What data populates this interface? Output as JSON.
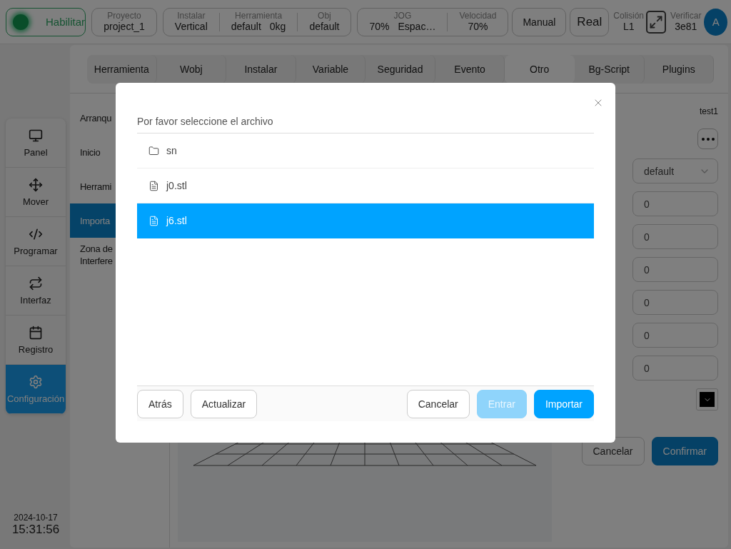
{
  "header": {
    "enable": {
      "label": "Habilitar",
      "on": true
    },
    "groups": [
      [
        {
          "label": "Proyecto",
          "values": [
            "project_1"
          ]
        }
      ],
      [
        {
          "label": "Instalar",
          "values": [
            "Vertical"
          ]
        },
        {
          "label": "Herramienta",
          "values": [
            "default",
            "0kg"
          ]
        },
        {
          "label": "Obj",
          "values": [
            "default"
          ]
        }
      ],
      [
        {
          "label": "JOG",
          "values": [
            "70%",
            "Espac…"
          ]
        },
        {
          "label": "Velocidad",
          "values": [
            "70%"
          ]
        }
      ]
    ],
    "mode_buttons": [
      "Manual",
      "Real"
    ],
    "collision": {
      "label": "Colisión",
      "value": "L1"
    },
    "verify": {
      "label": "Verificar",
      "value": "3e81"
    },
    "avatar": "A"
  },
  "nav": [
    {
      "label": "Panel",
      "selected": false
    },
    {
      "label": "Mover",
      "selected": false
    },
    {
      "label": "Programar",
      "selected": false
    },
    {
      "label": "Interfaz",
      "selected": false
    },
    {
      "label": "Registro",
      "selected": false
    },
    {
      "label": "Configuración",
      "selected": true
    }
  ],
  "datetime": {
    "date": "2024-10-17",
    "time": "15:31:56"
  },
  "tabs": [
    {
      "label": "Herramienta",
      "selected": false
    },
    {
      "label": "Wobj",
      "selected": false
    },
    {
      "label": "Instalar",
      "selected": false
    },
    {
      "label": "Variable",
      "selected": false
    },
    {
      "label": "Seguridad",
      "selected": false
    },
    {
      "label": "Evento",
      "selected": false
    },
    {
      "label": "Otro",
      "selected": true
    },
    {
      "label": "Bg-Script",
      "selected": false
    },
    {
      "label": "Plugins",
      "selected": false
    }
  ],
  "side_menu": [
    {
      "label": "Arranqu",
      "selected": false
    },
    {
      "label": "Inicio",
      "selected": false
    },
    {
      "label": "Herrami",
      "selected": false
    },
    {
      "label": "Importa",
      "selected": true
    },
    {
      "label": "Zona de Interfere",
      "selected": false
    }
  ],
  "settings": {
    "name": "test1",
    "tool": "default",
    "fields": [
      "0",
      "0",
      "0",
      "0",
      "0",
      "0"
    ],
    "actions": [
      {
        "label": "Cancelar",
        "kind": "default"
      },
      {
        "label": "Confirmar",
        "kind": "primary"
      }
    ]
  },
  "dialog": {
    "title": "Por favor seleccione el archivo",
    "items": [
      {
        "name": "sn",
        "kind": "folder",
        "selected": false
      },
      {
        "name": "j0.stl",
        "kind": "file",
        "selected": false
      },
      {
        "name": "j6.stl",
        "kind": "file",
        "selected": true
      }
    ],
    "left_buttons": [
      "Atrás",
      "Actualizar"
    ],
    "right_buttons": [
      {
        "label": "Cancelar",
        "kind": "default"
      },
      {
        "label": "Entrar",
        "kind": "disabled"
      },
      {
        "label": "Importar",
        "kind": "primary"
      }
    ]
  }
}
